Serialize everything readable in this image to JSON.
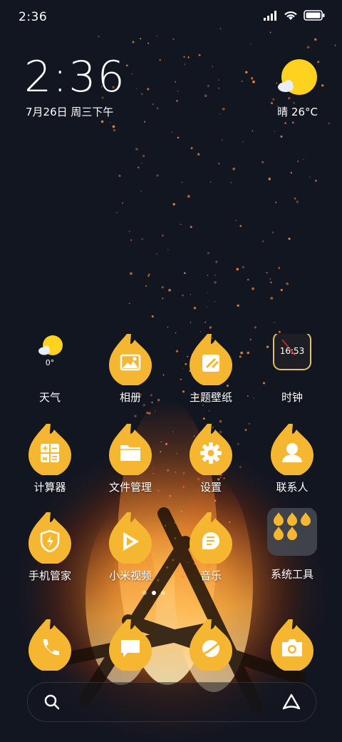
{
  "status_bar": {
    "time": "2:36"
  },
  "clock_widget": {
    "time": "2:36",
    "date": "7月26日 周三下午",
    "weather": "晴 26°C"
  },
  "apps": [
    {
      "label": "天气",
      "icon": "weather-icon",
      "sub": "0°"
    },
    {
      "label": "相册",
      "icon": "gallery-icon"
    },
    {
      "label": "主题壁纸",
      "icon": "themes-icon"
    },
    {
      "label": "时钟",
      "icon": "clock-icon",
      "time": "16:53"
    },
    {
      "label": "计算器",
      "icon": "calculator-icon"
    },
    {
      "label": "文件管理",
      "icon": "folder-icon"
    },
    {
      "label": "设置",
      "icon": "gear-icon"
    },
    {
      "label": "联系人",
      "icon": "contact-icon"
    },
    {
      "label": "手机管家",
      "icon": "shield-icon"
    },
    {
      "label": "小米视频",
      "icon": "video-icon"
    },
    {
      "label": "音乐",
      "icon": "music-icon"
    },
    {
      "label": "系统工具",
      "icon": "folder-tools-icon"
    }
  ],
  "dock": [
    {
      "name": "phone-icon"
    },
    {
      "name": "message-icon"
    },
    {
      "name": "browser-icon"
    },
    {
      "name": "camera-icon"
    }
  ],
  "colors": {
    "accent": "#F5B731",
    "background": "#121621"
  }
}
